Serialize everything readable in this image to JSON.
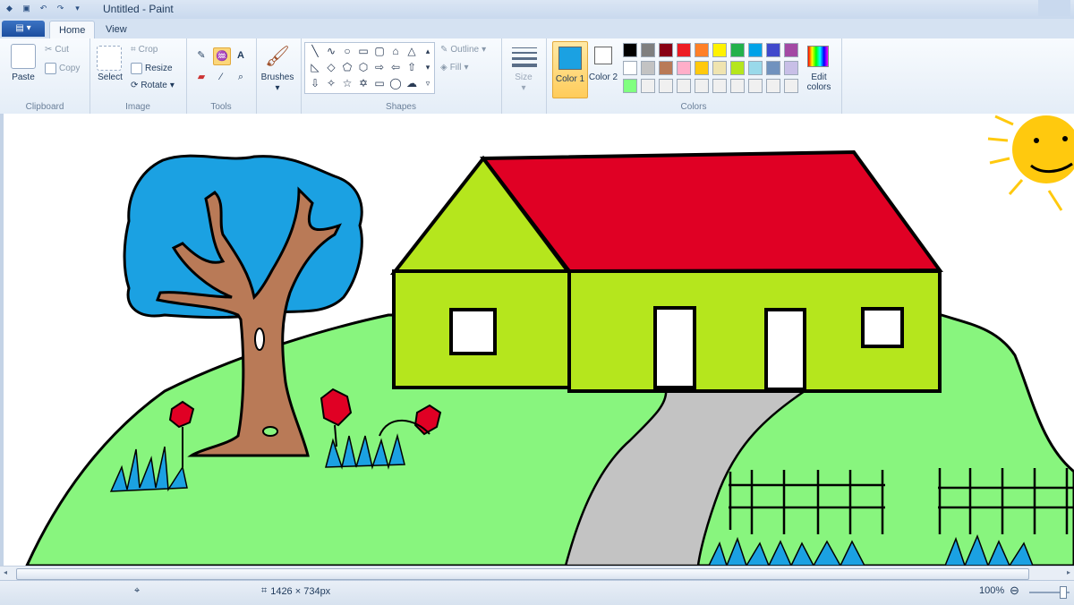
{
  "window": {
    "title": "Untitled - Paint"
  },
  "tabs": {
    "menu": "▤ ▾",
    "home": "Home",
    "view": "View"
  },
  "clipboard": {
    "group_label": "Clipboard",
    "paste": "Paste",
    "cut": "Cut",
    "copy": "Copy"
  },
  "image": {
    "group_label": "Image",
    "select": "Select",
    "crop": "Crop",
    "resize": "Resize",
    "rotate": "Rotate"
  },
  "tools": {
    "group_label": "Tools",
    "text_tool": "A"
  },
  "brushes": {
    "label": "Brushes"
  },
  "shapes": {
    "group_label": "Shapes",
    "outline": "Outline",
    "fill": "Fill"
  },
  "size": {
    "label": "Size"
  },
  "colors": {
    "group_label": "Colors",
    "color1_label": "Color 1",
    "color2_label": "Color 2",
    "edit_label": "Edit colors",
    "color1_value": "#1ba1e2",
    "color2_value": "#ffffff",
    "palette_row1": [
      "#000000",
      "#7f7f7f",
      "#880015",
      "#ed1c24",
      "#ff7f27",
      "#fff200",
      "#22b14c",
      "#00a2e8",
      "#3f48cc",
      "#a349a4"
    ],
    "palette_row2": [
      "#ffffff",
      "#c3c3c3",
      "#b97a57",
      "#ffaec9",
      "#ffc90e",
      "#efe4b0",
      "#b5e61d",
      "#99d9ea",
      "#7092be",
      "#c8bfe7"
    ],
    "palette_row3": [
      "#80ff80",
      "#f0f0f0",
      "#f0f0f0",
      "#f0f0f0",
      "#f0f0f0",
      "#f0f0f0",
      "#f0f0f0",
      "#f0f0f0",
      "#f0f0f0",
      "#f0f0f0"
    ]
  },
  "status": {
    "image_size": "1426 × 734px",
    "zoom": "100%"
  }
}
